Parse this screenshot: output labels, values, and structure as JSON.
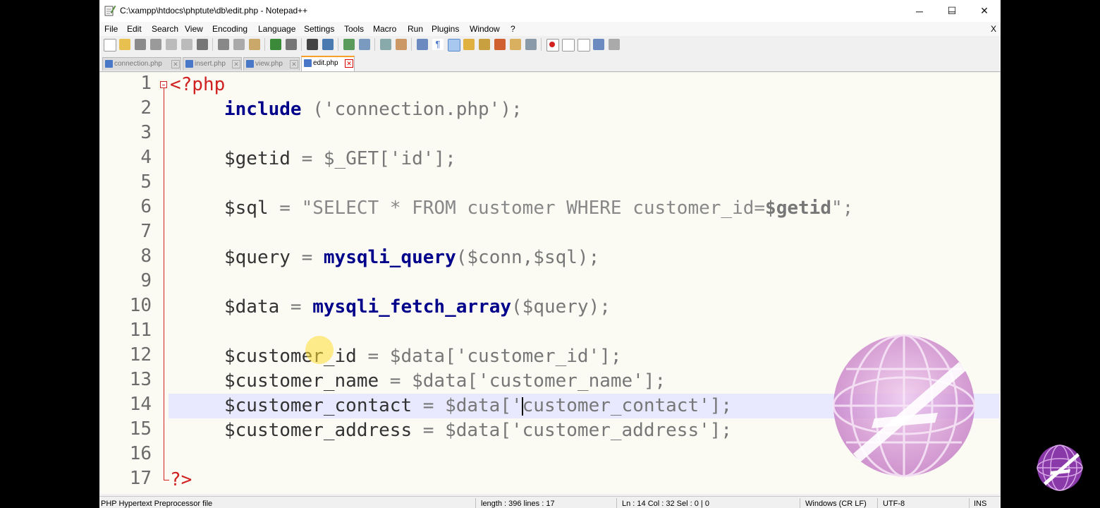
{
  "window": {
    "title": "C:\\xampp\\htdocs\\phptute\\db\\edit.php - Notepad++",
    "minimize_glyph": "─",
    "maximize_glyph": "☐",
    "close_glyph": "✕"
  },
  "menu": {
    "items": [
      "File",
      "Edit",
      "Search",
      "View",
      "Encoding",
      "Language",
      "Settings",
      "Tools",
      "Macro",
      "Run",
      "Plugins",
      "Window",
      "?"
    ],
    "close_label": "X"
  },
  "tabs": [
    {
      "label": "connection.php",
      "active": false
    },
    {
      "label": "insert.php",
      "active": false
    },
    {
      "label": "view.php",
      "active": false
    },
    {
      "label": "edit.php",
      "active": true
    }
  ],
  "tab_close_glyph": "✕",
  "editor": {
    "line_numbers": [
      "1",
      "2",
      "3",
      "4",
      "5",
      "6",
      "7",
      "8",
      "9",
      "10",
      "11",
      "12",
      "13",
      "14",
      "15",
      "16",
      "17"
    ],
    "current_line": 14,
    "code": {
      "l1_open": "<?php",
      "l2_kw": "include",
      "l2_rest": " ('connection.php');",
      "l4_var": "$getid",
      "l4_rest": " = $_GET['id'];",
      "l6_var": "$sql",
      "l6_op": " = ",
      "l6_str": "\"SELECT * FROM customer WHERE customer_id=",
      "l6_strvar": "$getid",
      "l6_end": "\";",
      "l8_var": "$query",
      "l8_op": " = ",
      "l8_fn": "mysqli_query",
      "l8_rest": "($conn,$sql);",
      "l10_var": "$data",
      "l10_op": " = ",
      "l10_fn": "mysqli_fetch_array",
      "l10_rest": "($query);",
      "l12_var": "$customer_id",
      "l12_rest": " = $data['customer_id'];",
      "l13_var": "$customer_name",
      "l13_rest": " = $data['customer_name'];",
      "l14_var": "$customer_contact",
      "l14_pre": " = $data['",
      "l14_post": "customer_contact'];",
      "l15_var": "$customer_address",
      "l15_rest": " = $data['customer_address'];",
      "l17_close": "?>"
    }
  },
  "statusbar": {
    "file_type": "PHP Hypertext Preprocessor file",
    "length": "length : 396    lines : 17",
    "position": "Ln : 14    Col : 32    Sel : 0 | 0",
    "eol": "Windows (CR LF)",
    "encoding": "UTF-8",
    "mode": "INS"
  },
  "colors": {
    "php_tag": "#d02020",
    "keyword": "#00008b",
    "active_tab_accent": "#f9a02a",
    "current_line_bg": "#e8e8ff",
    "editor_bg": "#fbfbf4"
  }
}
